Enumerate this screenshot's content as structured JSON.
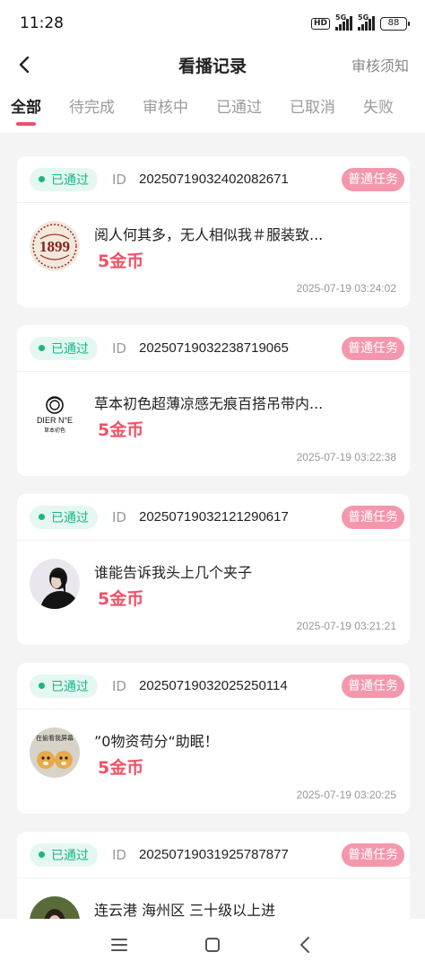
{
  "status_bar": {
    "time": "11:28",
    "hd": "HD",
    "net1": "5G",
    "net2": "5G",
    "battery": "88"
  },
  "header": {
    "title": "看播记录",
    "rules_link": "审核须知"
  },
  "tabs": [
    {
      "label": "全部",
      "active": true
    },
    {
      "label": "待完成",
      "active": false
    },
    {
      "label": "审核中",
      "active": false
    },
    {
      "label": "已通过",
      "active": false
    },
    {
      "label": "已取消",
      "active": false
    },
    {
      "label": "失败",
      "active": false
    }
  ],
  "records": [
    {
      "status": "已通过",
      "id_label": "ID",
      "id": "20250719032402082671",
      "type": "普通任务",
      "title": "阅人何其多，无人相似我＃服装致...",
      "reward": "5金币",
      "time": "2025-07-19 03:24:02",
      "thumb_text": "1899"
    },
    {
      "status": "已通过",
      "id_label": "ID",
      "id": "20250719032238719065",
      "type": "普通任务",
      "title": "草本初色超薄凉感无痕百搭吊带内...",
      "reward": "5金币",
      "time": "2025-07-19 03:22:38",
      "thumb_text": "DIER N°E",
      "thumb_sub": "草本初色"
    },
    {
      "status": "已通过",
      "id_label": "ID",
      "id": "20250719032121290617",
      "type": "普通任务",
      "title": "谁能告诉我头上几个夹子",
      "reward": "5金币",
      "time": "2025-07-19 03:21:21"
    },
    {
      "status": "已通过",
      "id_label": "ID",
      "id": "20250719032025250114",
      "type": "普通任务",
      "title": "”0物资苟分“助眠！",
      "reward": "5金币",
      "time": "2025-07-19 03:20:25",
      "thumb_text": "在偷看我屏幕"
    },
    {
      "status": "已通过",
      "id_label": "ID",
      "id": "20250719031925787877",
      "type": "普通任务",
      "title": "连云港 海州区 三十级以上进",
      "reward": "",
      "time": ""
    }
  ],
  "colors": {
    "accent": "#f0506e",
    "success": "#16b68a",
    "task_badge": "#f497ac",
    "reward": "#f05266"
  }
}
